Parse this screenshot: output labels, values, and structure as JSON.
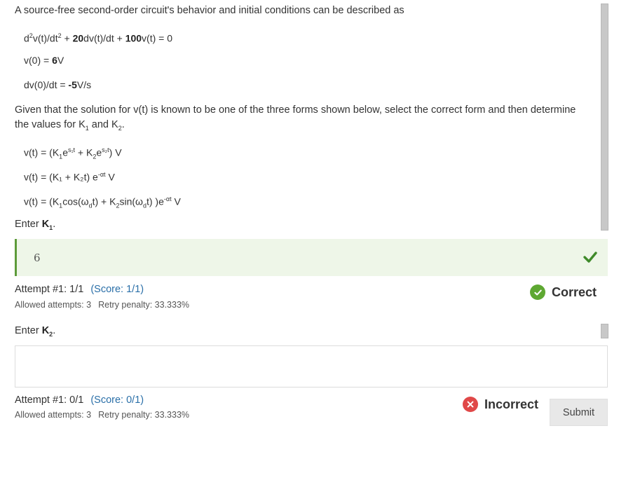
{
  "intro": "A source-free second-order circuit's behavior and initial conditions can be described as",
  "equation": {
    "p1": "d",
    "p1sup": "2",
    "p2": "v(t)/dt",
    "p2sup": "2",
    "p3": " + ",
    "c1": "20",
    "p4": "dv(t)/dt + ",
    "c2": "100",
    "p5": "v(t) = 0"
  },
  "ic1": {
    "pre": "v(0) = ",
    "val": "6",
    "unit": "V"
  },
  "ic2": {
    "pre": "dv(0)/dt = ",
    "val": "-5",
    "unit": "V/s"
  },
  "prompt": {
    "line1": "Given that the solution for v(t) is known to be one of the three forms shown below, select the correct form and then determine",
    "line2_a": "the values for K",
    "line2_sub1": "1",
    "line2_b": " and K",
    "line2_sub2": "2",
    "line2_c": "."
  },
  "forms": {
    "f1": {
      "a": "v(t) = (K",
      "s1": "1",
      "b": "e",
      "sup1": "s₁t",
      "c": " + K",
      "s2": "2",
      "d": "e",
      "sup2": "s₂t",
      "e": ") V"
    },
    "f2": {
      "a": "v(t) = (K₁ + K₂t) e",
      "sup": "-αt",
      "b": " V"
    },
    "f3": {
      "a": "v(t) = (K",
      "s1": "1",
      "b": "cos(ω",
      "s2": "d",
      "c": "t) + K",
      "s3": "2",
      "d": "sin(ω",
      "s4": "d",
      "e": "t) )e",
      "sup": "-αt",
      "f": " V"
    }
  },
  "q1": {
    "label_pre": "Enter ",
    "label_var": "K",
    "label_sub": "1",
    "label_post": ".",
    "answer": "6",
    "attempt": "Attempt #1: 1/1",
    "score": "(Score: 1/1)",
    "allowed": "Allowed attempts: 3",
    "penalty": "Retry penalty: 33.333%",
    "status": "Correct",
    "status_color": "#5ea832"
  },
  "q2": {
    "label_pre": "Enter ",
    "label_var": "K",
    "label_sub": "2",
    "label_post": ".",
    "answer": "",
    "attempt": "Attempt #1: 0/1",
    "score": "(Score: 0/1)",
    "allowed": "Allowed attempts: 3",
    "penalty": "Retry penalty: 33.333%",
    "status": "Incorrect",
    "status_color": "#e04848",
    "submit_label": "Submit"
  }
}
